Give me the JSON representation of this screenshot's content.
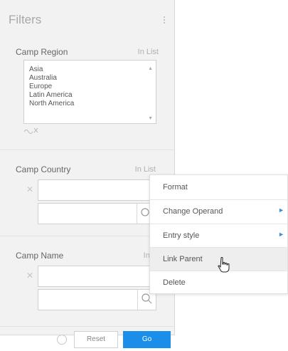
{
  "panel": {
    "title": "Filters",
    "icons": {
      "menu": "kebab-icon",
      "link": "link-icon",
      "clear": "clear-x-icon",
      "search": "search-icon",
      "reset": "reset-icon"
    },
    "accent": "#1a8ee8"
  },
  "camp_region": {
    "label": "Camp Region",
    "operand": "In List",
    "options": [
      "Asia",
      "Australia",
      "Europe",
      "Latin America",
      "North America"
    ]
  },
  "camp_country": {
    "label": "Camp Country",
    "operand": "In List"
  },
  "camp_name": {
    "label": "Camp Name",
    "operand": "In L"
  },
  "footer": {
    "reset_label": "Reset",
    "go_label": "Go"
  },
  "context_menu": {
    "items": [
      {
        "label": "Format",
        "submenu": false
      },
      {
        "label": "Change Operand",
        "submenu": true
      },
      {
        "label": "Entry style",
        "submenu": true
      },
      {
        "label": "Link Parent",
        "submenu": false,
        "hovered": true
      },
      {
        "label": "Delete",
        "submenu": false
      }
    ]
  }
}
